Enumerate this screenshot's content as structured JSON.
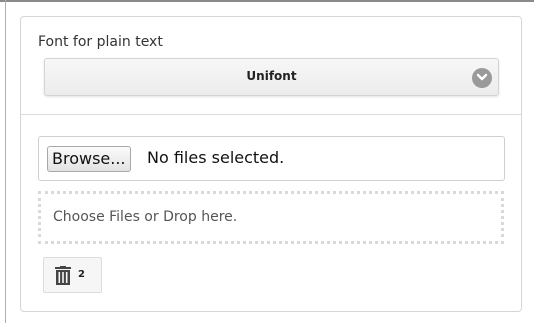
{
  "font_setting": {
    "label": "Font for plain text",
    "selected": "Unifont"
  },
  "file_input": {
    "browse_label": "Browse...",
    "status": "No files selected."
  },
  "drop_zone": {
    "text": "Choose Files or Drop here."
  },
  "trash": {
    "icon": "trash-icon",
    "count": "2"
  },
  "icons": {
    "select_indicator": "chevron-down-icon"
  }
}
